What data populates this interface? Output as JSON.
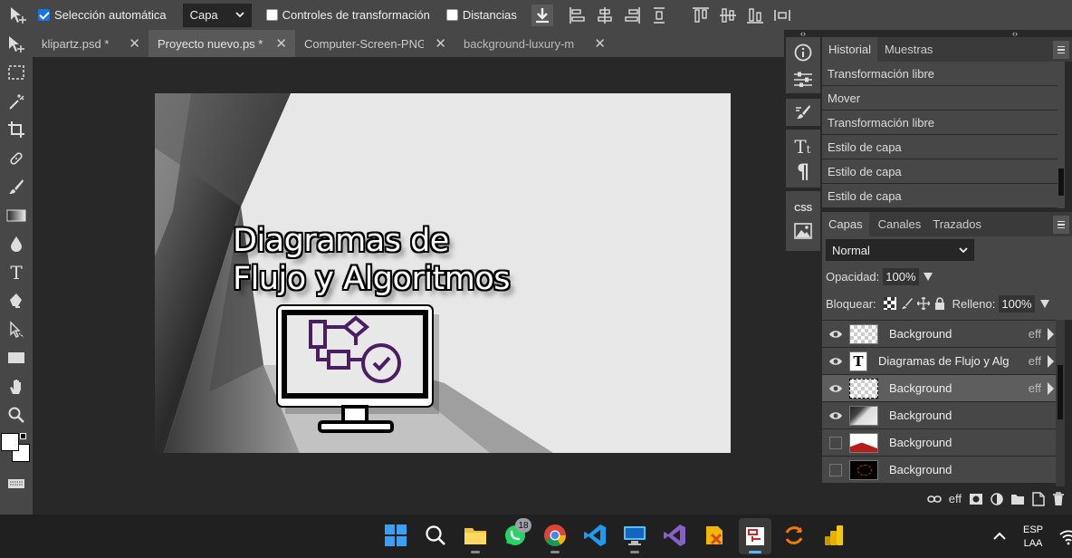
{
  "toolbar": {
    "auto_select_label": "Selección automática",
    "auto_select_checked": true,
    "select_value": "Capa",
    "transform_controls_label": "Controles de transformación",
    "distances_label": "Distancias"
  },
  "tabs": [
    {
      "label": "klipartz.psd *",
      "active": false
    },
    {
      "label": "Proyecto nuevo.ps *",
      "active": true
    },
    {
      "label": "Computer-Screen-PNG",
      "active": false
    },
    {
      "label": "background-luxury-m",
      "active": false
    }
  ],
  "canvas": {
    "title_line1": "Diagramas de",
    "title_line2": "Flujo y Algoritmos"
  },
  "history": {
    "tabs": [
      "Historial",
      "Muestras"
    ],
    "items": [
      "Transformación libre",
      "Mover",
      "Transformación libre",
      "Estilo de capa",
      "Estilo de capa",
      "Estilo de capa"
    ]
  },
  "layers": {
    "tabs": [
      "Capas",
      "Canales",
      "Trazados"
    ],
    "blend_mode": "Normal",
    "opacity_label": "Opacidad:",
    "opacity_value": "100%",
    "lock_label": "Bloquear:",
    "fill_label": "Relleno:",
    "fill_value": "100%",
    "items": [
      {
        "name": "Background",
        "eff": "eff",
        "visible": true,
        "thumb": "checker"
      },
      {
        "name": "Diagramas de Flujo y Alg",
        "eff": "eff",
        "visible": true,
        "thumb": "text",
        "thumb_text": "T"
      },
      {
        "name": "Background",
        "eff": "eff",
        "visible": true,
        "thumb": "checker",
        "selected": true
      },
      {
        "name": "Background",
        "eff": "",
        "visible": true,
        "thumb": "gray"
      },
      {
        "name": "Background",
        "eff": "",
        "visible": false,
        "thumb": "red"
      },
      {
        "name": "Background",
        "eff": "",
        "visible": false,
        "thumb": "dark"
      }
    ],
    "footer_eff": "eff"
  },
  "side_icons": {
    "css_label": "CSS"
  },
  "taskbar": {
    "whatsapp_badge": "18",
    "lang": "ESP",
    "layout": "LAA"
  },
  "colors": {
    "toolbar_bg": "#474747",
    "workspace_bg": "#282828",
    "accent_blue": "#1a73e8",
    "purple_icon": "#4b1d63"
  }
}
